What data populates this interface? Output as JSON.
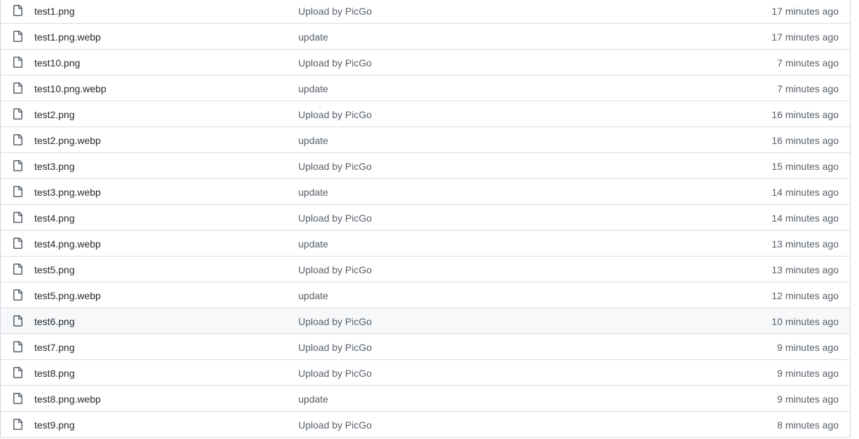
{
  "file_list": {
    "icon": "file-icon",
    "rows": [
      {
        "name": "test1.png",
        "commit": "Upload by PicGo",
        "age": "17 minutes ago"
      },
      {
        "name": "test1.png.webp",
        "commit": "update",
        "age": "17 minutes ago"
      },
      {
        "name": "test10.png",
        "commit": "Upload by PicGo",
        "age": "7 minutes ago"
      },
      {
        "name": "test10.png.webp",
        "commit": "update",
        "age": "7 minutes ago"
      },
      {
        "name": "test2.png",
        "commit": "Upload by PicGo",
        "age": "16 minutes ago"
      },
      {
        "name": "test2.png.webp",
        "commit": "update",
        "age": "16 minutes ago"
      },
      {
        "name": "test3.png",
        "commit": "Upload by PicGo",
        "age": "15 minutes ago"
      },
      {
        "name": "test3.png.webp",
        "commit": "update",
        "age": "14 minutes ago"
      },
      {
        "name": "test4.png",
        "commit": "Upload by PicGo",
        "age": "14 minutes ago"
      },
      {
        "name": "test4.png.webp",
        "commit": "update",
        "age": "13 minutes ago"
      },
      {
        "name": "test5.png",
        "commit": "Upload by PicGo",
        "age": "13 minutes ago"
      },
      {
        "name": "test5.png.webp",
        "commit": "update",
        "age": "12 minutes ago"
      },
      {
        "name": "test6.png",
        "commit": "Upload by PicGo",
        "age": "10 minutes ago"
      },
      {
        "name": "test7.png",
        "commit": "Upload by PicGo",
        "age": "9 minutes ago"
      },
      {
        "name": "test8.png",
        "commit": "Upload by PicGo",
        "age": "9 minutes ago"
      },
      {
        "name": "test8.png.webp",
        "commit": "update",
        "age": "9 minutes ago"
      },
      {
        "name": "test9.png",
        "commit": "Upload by PicGo",
        "age": "8 minutes ago"
      }
    ]
  }
}
